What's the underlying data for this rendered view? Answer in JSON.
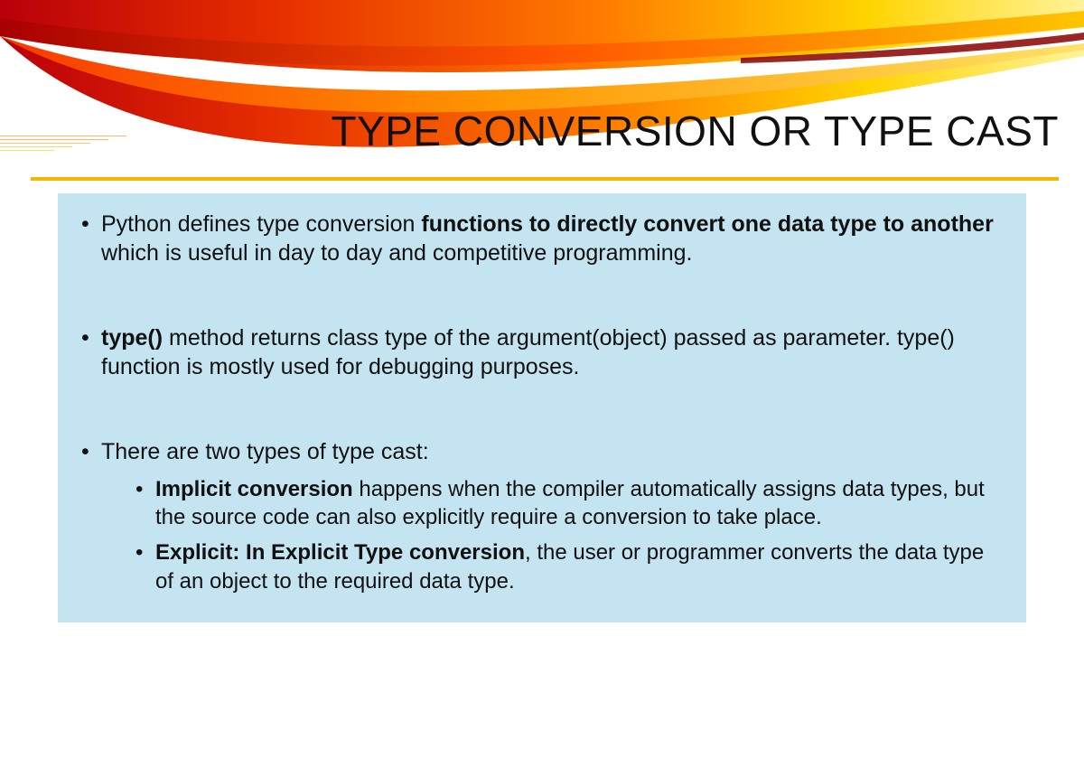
{
  "slide": {
    "title": "TYPE CONVERSION OR TYPE CAST",
    "bullets": [
      {
        "pre": "Python defines type conversion ",
        "bold": "functions to directly convert one data type to another",
        "post": " which is useful in day to day and competitive programming."
      },
      {
        "bold": "type()",
        "post": " method returns class type of the argument(object) passed as parameter. type() function is mostly used for debugging purposes."
      },
      {
        "pre": "There are two types of type cast:",
        "sub": [
          {
            "bold": "Implicit conversion",
            "post": " happens when the compiler automatically assigns data types, but the source code can also explicitly require a conversion to take place."
          },
          {
            "bold": "Explicit: In Explicit Type conversion",
            "post": ", the user or programmer converts the data type of an object to the required data type."
          }
        ]
      }
    ]
  }
}
